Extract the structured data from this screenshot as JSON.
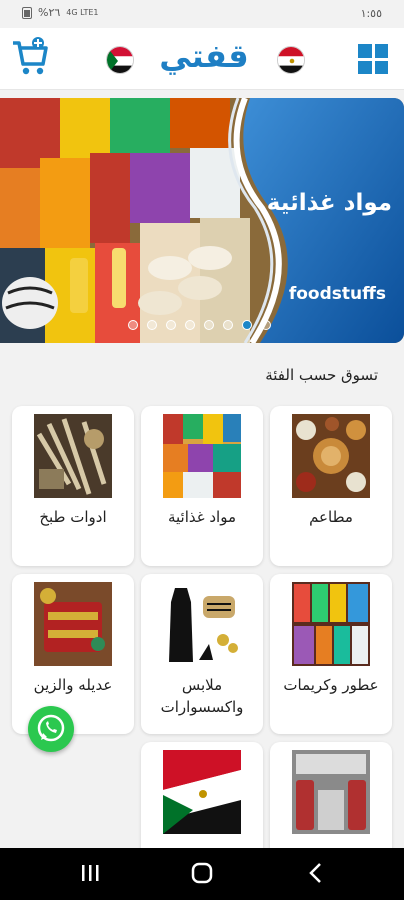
{
  "status_bar": {
    "time": "١:٥٥",
    "battery": "%٢٦",
    "network": "4G LTE1"
  },
  "header": {
    "logo_text": "قفتي",
    "icons": [
      "cart-icon",
      "sudan-flag-icon",
      "egypt-flag-icon",
      "grid-menu-icon"
    ]
  },
  "banner": {
    "title_ar": "مواد غذائية",
    "title_en": "foodstuffs",
    "slide_count": 8,
    "active_slide": 7
  },
  "categories_title": "تسوق حسب الفئة",
  "categories": [
    {
      "label": "مطاعم"
    },
    {
      "label": "مواد غذائية"
    },
    {
      "label": "ادوات طبخ"
    },
    {
      "label": "عطور وكريمات"
    },
    {
      "label": "ملابس واكسسوارات"
    },
    {
      "label": "عديله والزين"
    },
    {
      "label": ""
    },
    {
      "label": ""
    }
  ],
  "colors": {
    "accent": "#1c86c7",
    "whatsapp": "#2bc84f"
  }
}
